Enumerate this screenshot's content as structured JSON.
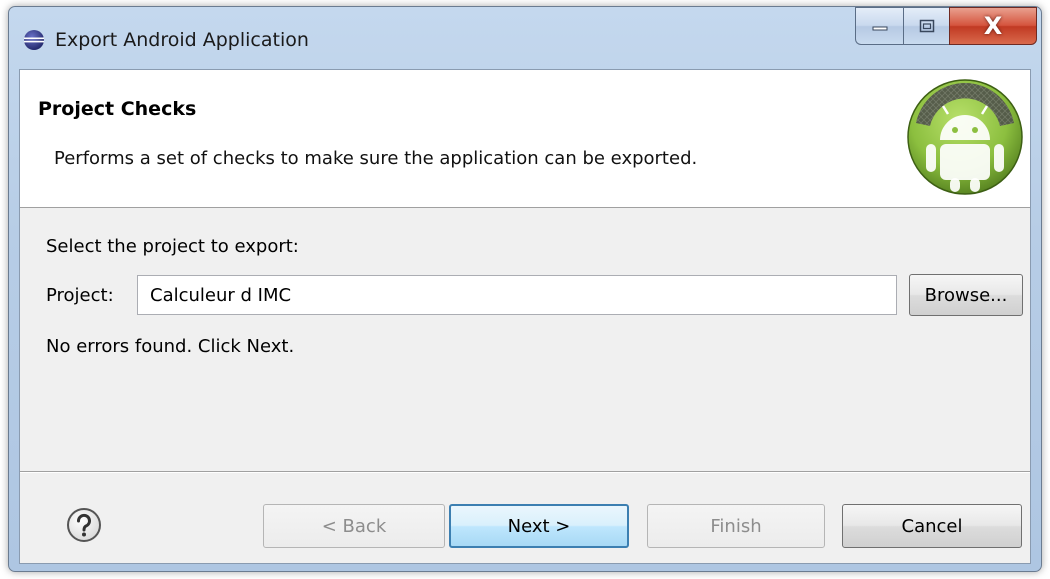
{
  "window": {
    "title": "Export Android Application",
    "close_glyph": "X"
  },
  "banner": {
    "title": "Project Checks",
    "description": "Performs a set of checks to make sure the application can be exported.",
    "logo_icon": "android-logo-icon"
  },
  "form": {
    "select_label": "Select the project to export:",
    "project_label": "Project:",
    "project_value": "Calculeur d IMC",
    "browse_label": "Browse...",
    "status": "No errors found. Click Next."
  },
  "footer": {
    "help_icon": "help-icon",
    "back_label": "< Back",
    "next_label": "Next >",
    "finish_label": "Finish",
    "cancel_label": "Cancel"
  },
  "colors": {
    "accent": "#3c7fb1",
    "close_red": "#c13a23",
    "android_green": "#8cbf3f"
  }
}
